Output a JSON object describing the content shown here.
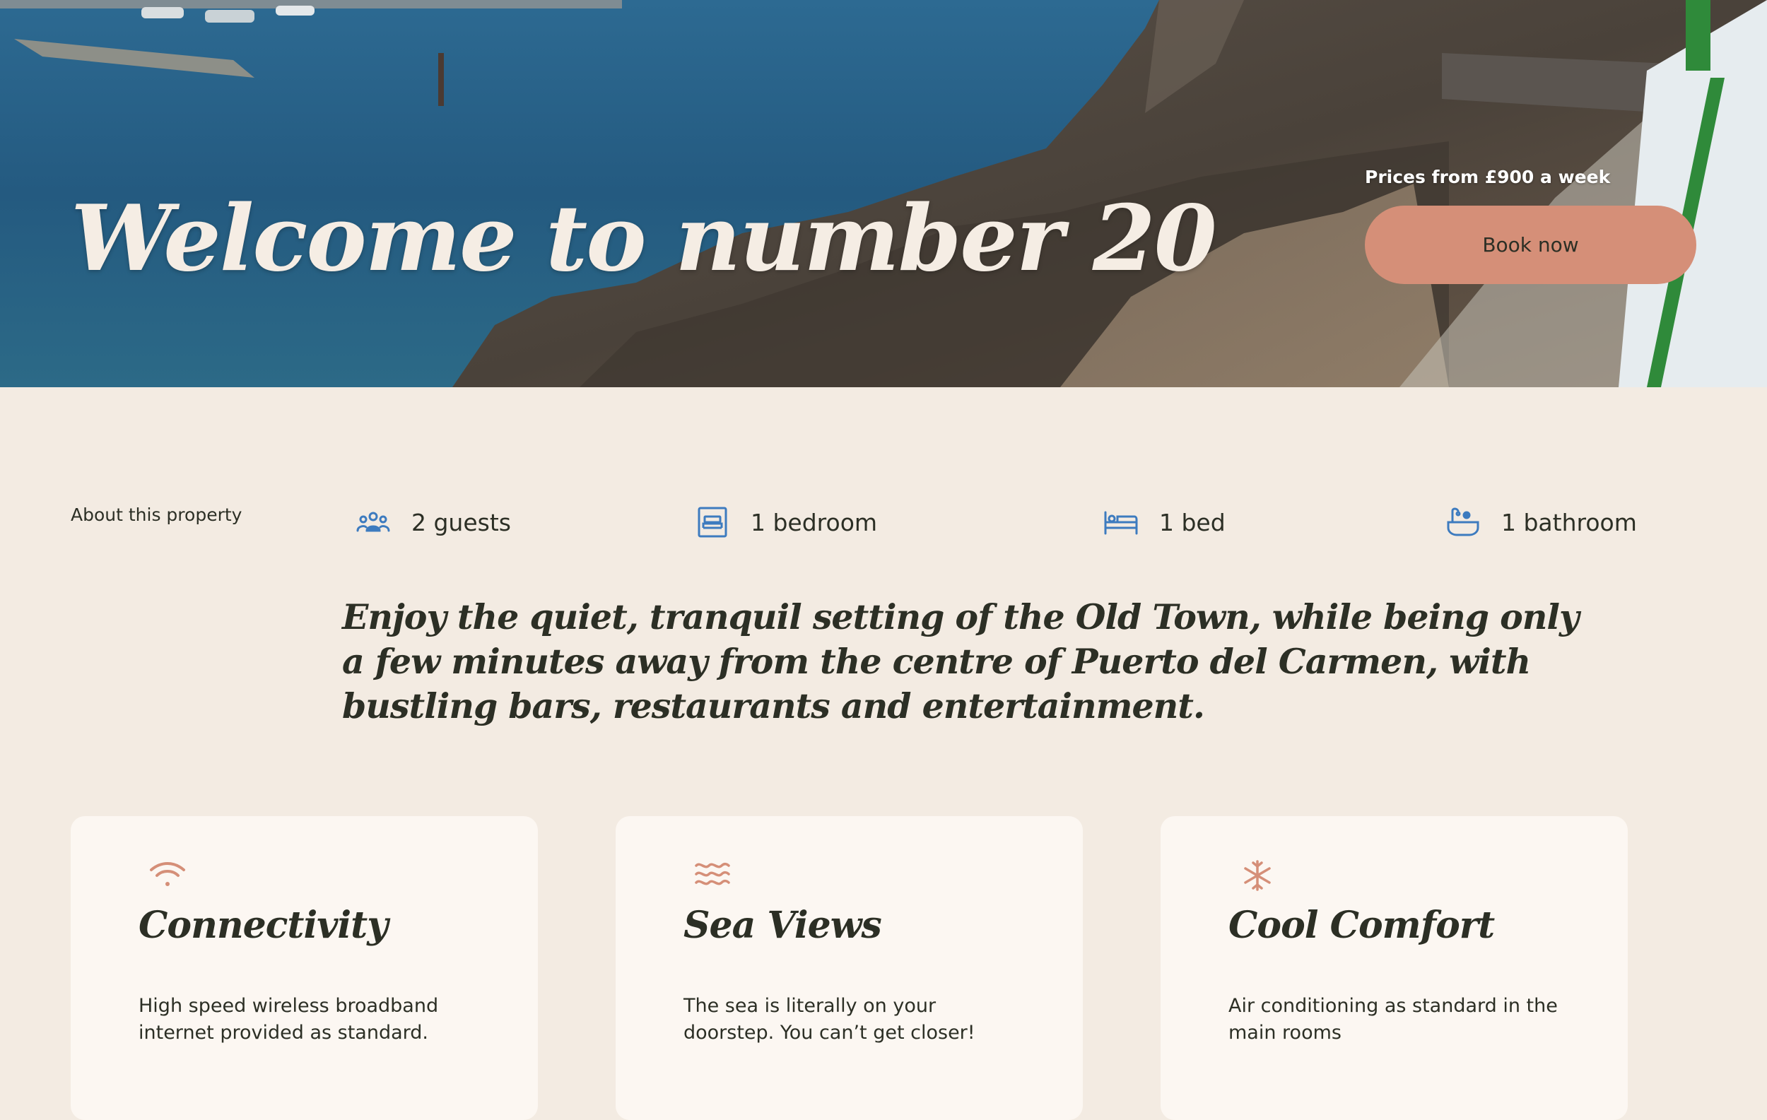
{
  "hero": {
    "title": "Welcome to number 20",
    "price_text": "Prices from £900 a week",
    "book_label": "Book now"
  },
  "about": {
    "label": "About this property",
    "features": [
      {
        "icon": "guests-icon",
        "label": "2 guests"
      },
      {
        "icon": "bedroom-icon",
        "label": "1 bedroom"
      },
      {
        "icon": "bed-icon",
        "label": "1 bed"
      },
      {
        "icon": "bathroom-icon",
        "label": "1 bathroom"
      }
    ],
    "intro": "Enjoy the quiet, tranquil setting of the Old Town, while being only a few minutes away from the centre of Puerto del Carmen, with bustling bars, restaurants and entertainment."
  },
  "cards": [
    {
      "icon": "wifi-icon",
      "title": "Connectivity",
      "description": "High speed wireless broadband internet provided as standard."
    },
    {
      "icon": "waves-icon",
      "title": "Sea Views",
      "description": "The sea is literally on your doorstep. You can’t get closer!"
    },
    {
      "icon": "snowflake-icon",
      "title": "Cool Comfort",
      "description": "Air conditioning as standard in the main rooms"
    }
  ],
  "colors": {
    "background": "#f3ebe2",
    "card": "#fcf7f2",
    "accent": "#d58f78",
    "icon_blue": "#3d7bbf",
    "text": "#2c2f25"
  }
}
